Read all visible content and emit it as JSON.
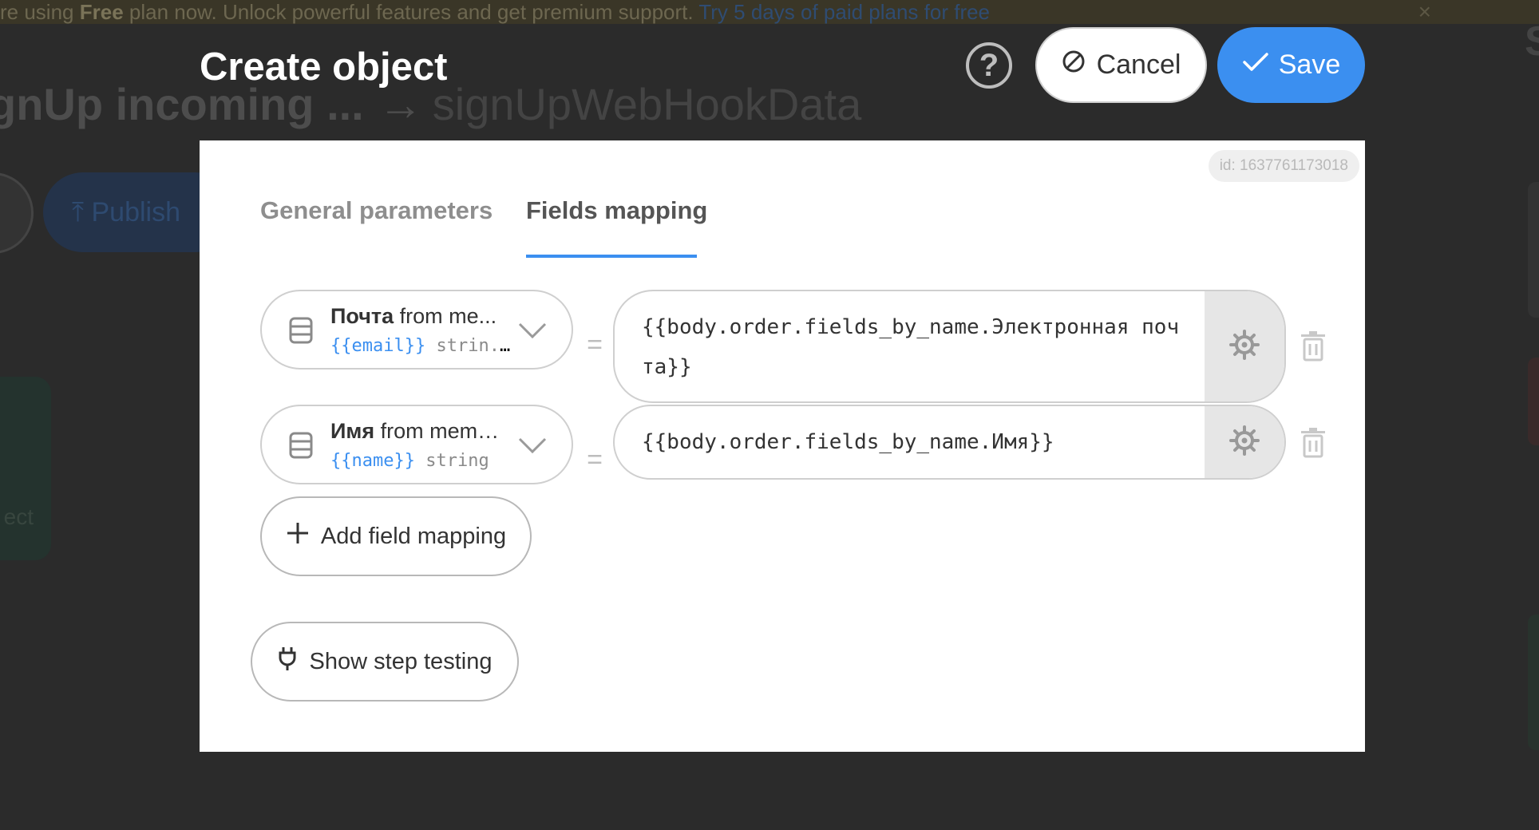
{
  "background": {
    "banner": {
      "text_before": "re using ",
      "plan": "Free",
      "text_after": " plan now. Unlock powerful features and get premium support. ",
      "link": "Try 5 days of paid plans for free",
      "close": "×"
    },
    "title": "gnUp incoming ...",
    "arrow": "→",
    "entity": "signUpWebHookData",
    "publish_label": "Publish",
    "card_text": "ect",
    "right_letter": "S"
  },
  "modal": {
    "title": "Create object",
    "help": "?",
    "cancel_label": "Cancel",
    "save_label": "Save",
    "id_badge": "id: 1637761173018",
    "tabs": [
      {
        "label": "General parameters",
        "active": false
      },
      {
        "label": "Fields mapping",
        "active": true
      }
    ],
    "mappings": [
      {
        "field_name": "Почта",
        "field_source": " from me...",
        "field_var": "{{email}}",
        "field_type": " strin...",
        "equals": "=",
        "value": "{{body.order.fields_by_name.Электронная почта}}"
      },
      {
        "field_name": "Имя",
        "field_source": " from memb...",
        "field_var": "{{name}}",
        "field_type": " string",
        "equals": "=",
        "value": "{{body.order.fields_by_name.Имя}}"
      }
    ],
    "add_mapping_label": "Add field mapping",
    "show_testing_label": "Show step testing"
  },
  "colors": {
    "accent": "#3b8ff0",
    "overlay": "#2b2b2b",
    "muted_text": "#8e8e8e"
  }
}
